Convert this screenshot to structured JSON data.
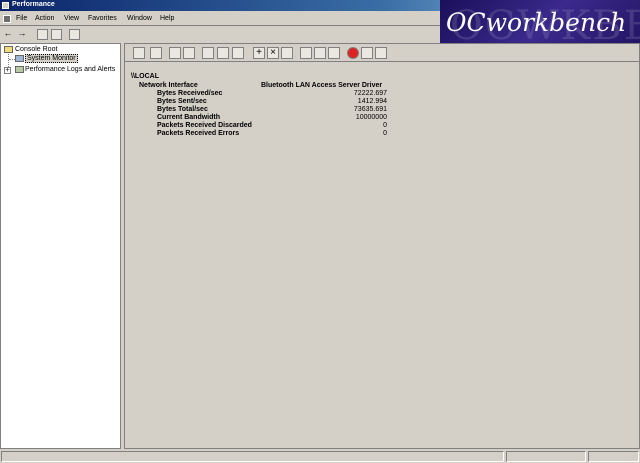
{
  "window": {
    "title": "Performance"
  },
  "menu": {
    "items": [
      "File",
      "Action",
      "View",
      "Favorites",
      "Window",
      "Help"
    ]
  },
  "nav": {
    "back": "←",
    "forward": "→"
  },
  "logo": {
    "text": "OCworkbench",
    "ghost_text": "OCWKBE"
  },
  "tree": {
    "root": "Console Root",
    "children": [
      "System Monitor",
      "Performance Logs and Alerts"
    ],
    "expand_symbol": "+"
  },
  "toolbar": {
    "add_symbol": "+",
    "delete_symbol": "×"
  },
  "report": {
    "computer": "\\\\LOCAL",
    "object": "Network Interface",
    "instance": "Bluetooth LAN Access Server Driver",
    "counters": [
      {
        "name": "Bytes Received/sec",
        "value": "72222.697"
      },
      {
        "name": "Bytes Sent/sec",
        "value": "1412.994"
      },
      {
        "name": "Bytes Total/sec",
        "value": "73635.691"
      },
      {
        "name": "Current Bandwidth",
        "value": "10000000"
      },
      {
        "name": "Packets Received Discarded",
        "value": "0"
      },
      {
        "name": "Packets Received Errors",
        "value": "0"
      }
    ]
  },
  "colors": {
    "title_bar": "#0a246a",
    "logo_bg": "#3b2a8c",
    "chrome": "#d4d0c8"
  }
}
